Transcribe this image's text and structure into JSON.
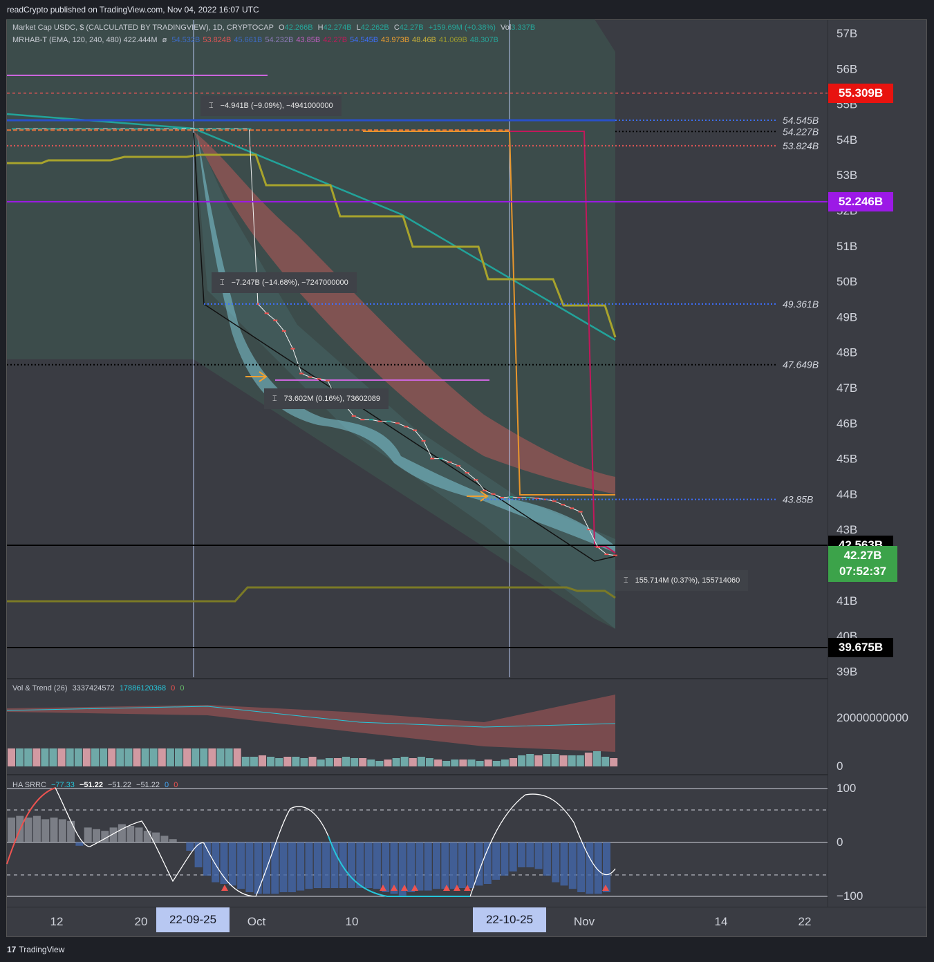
{
  "header": {
    "publisher_text": "readCrypto published on TradingView.com, Nov 04, 2022 16:07 UTC"
  },
  "footer": {
    "brand": "TradingView",
    "logo_glyph": "17"
  },
  "legend": {
    "main": {
      "title": "Market Cap USDC, $ (CALCULATED BY TRADINGVIEW), 1D, CRYPTOCAP",
      "o_label": "O",
      "o_value": "42.266B",
      "h_label": "H",
      "h_value": "42.274B",
      "l_label": "L",
      "l_value": "42.262B",
      "c_label": "C",
      "c_value": "42.27B",
      "change": "+159.69M (+0.38%)",
      "vol_label": "Vol",
      "vol_value": "3.337B"
    },
    "mrhab": {
      "title": "MRHAB-T (EMA, 120, 240, 480)  422.444M",
      "symbol": "ø",
      "values": [
        {
          "text": "54.532B",
          "color": "#3d6bc4"
        },
        {
          "text": "53.824B",
          "color": "#e05555"
        },
        {
          "text": "45.661B",
          "color": "#3d6bc4"
        },
        {
          "text": "54.232B",
          "color": "#8c7ab8"
        },
        {
          "text": "43.85B",
          "color": "#c05fc0"
        },
        {
          "text": "42.27B",
          "color": "#c2185b"
        },
        {
          "text": "54.545B",
          "color": "#3d6fff"
        },
        {
          "text": "43.973B",
          "color": "#f0a030"
        },
        {
          "text": "48.46B",
          "color": "#c9b13a"
        },
        {
          "text": "41.069B",
          "color": "#9c9a2e"
        },
        {
          "text": "48.307B",
          "color": "#26a69a"
        }
      ]
    },
    "vol_trend": {
      "title": "Vol & Trend (26)",
      "v1": "3337424572",
      "v2": "17886120368",
      "v3": "0",
      "v4": "0"
    },
    "ha_srrc": {
      "title": "HA SRRC",
      "v1": "−77.33",
      "v2": "−51.22",
      "v3": "−51.22",
      "v4": "−51.22",
      "v5": "0",
      "v6": "0"
    }
  },
  "price_tags": [
    {
      "text": "55.309B",
      "price": 55.309,
      "bg": "#e8130f",
      "fg": "#ffffff"
    },
    {
      "text": "52.246B",
      "price": 52.246,
      "bg": "#9c19e6",
      "fg": "#ffffff"
    },
    {
      "text": "42.563B",
      "price": 42.563,
      "bg": "#000000",
      "fg": "#ffffff"
    },
    {
      "text": "39.675B",
      "price": 39.675,
      "bg": "#000000",
      "fg": "#ffffff"
    }
  ],
  "current_tag": {
    "price_text": "42.27B",
    "timer": "07:52:37",
    "bg": "#3ca34a"
  },
  "level_labels": [
    {
      "text": "54.545B",
      "price": 54.545
    },
    {
      "text": "54.227B",
      "price": 54.227
    },
    {
      "text": "53.824B",
      "price": 53.824
    },
    {
      "text": "49.361B",
      "price": 49.361
    },
    {
      "text": "47.649B",
      "price": 47.649
    },
    {
      "text": "43.85B",
      "price": 43.85
    }
  ],
  "measurements": [
    {
      "text": "−4.941B (−9.09%), −4941000000"
    },
    {
      "text": "−7.247B (−14.68%), −7247000000"
    },
    {
      "text": "73.602M (0.16%), 73602089"
    },
    {
      "text": "155.714M (0.37%), 155714060"
    }
  ],
  "date_chips": [
    "22-09-25",
    "22-10-25"
  ],
  "osc_axis_labels": [
    "100",
    "0",
    "−100"
  ],
  "vol_axis_labels": [
    "20000000000",
    "0"
  ],
  "chart_data": {
    "type": "line",
    "title": "Market Cap USDC, $ (CALCULATED BY TRADINGVIEW), 1D, CRYPTOCAP",
    "timeframe": "1D",
    "x_tick_labels": [
      "12",
      "20",
      "Oct",
      "10",
      "Nov",
      "14",
      "22"
    ],
    "y_tick_labels": [
      "57B",
      "56B",
      "55B",
      "54B",
      "53B",
      "52B",
      "51B",
      "50B",
      "49B",
      "48B",
      "47B",
      "46B",
      "45B",
      "44B",
      "43B",
      "42B",
      "41B",
      "40B",
      "39B"
    ],
    "ylim": [
      38.8,
      57.3
    ],
    "y_unit": "B",
    "series": [
      {
        "name": "Market Cap USDC",
        "color": "#e8e8e8",
        "values": [
          54.3,
          54.3,
          54.3,
          54.3,
          54.3,
          54.3,
          54.3,
          54.3,
          54.3,
          54.3,
          54.3,
          54.3,
          54.3,
          54.3,
          54.3,
          54.3,
          54.3,
          54.3,
          54.3,
          54.3,
          54.3,
          54.3,
          54.3,
          54.3,
          54.3,
          54.3,
          54.3,
          54.3,
          49.36,
          49.1,
          48.9,
          48.6,
          48.1,
          47.4,
          47.3,
          47.25,
          47.2,
          46.7,
          46.5,
          46.2,
          46.1,
          46.1,
          46.05,
          46.05,
          46.0,
          45.9,
          45.8,
          45.5,
          45.0,
          45.0,
          44.9,
          44.8,
          44.6,
          44.4,
          44.1,
          44.0,
          43.9,
          43.92,
          43.9,
          43.9,
          43.88,
          43.85,
          43.8,
          43.7,
          43.6,
          43.5,
          43.0,
          42.5,
          42.3,
          42.27
        ]
      }
    ]
  }
}
